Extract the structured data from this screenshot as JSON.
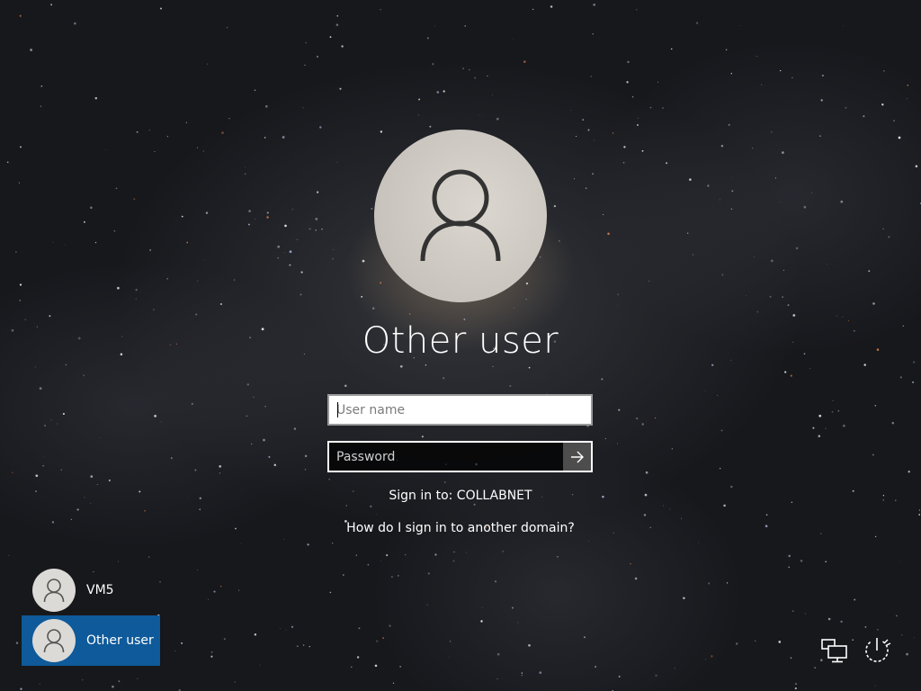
{
  "login": {
    "user_title": "Other user",
    "username_placeholder": "User name",
    "password_placeholder": "Password",
    "signin_to": "Sign in to: COLLABNET",
    "domain_help_link": "How do I sign in to another domain?"
  },
  "user_tiles": [
    {
      "label": "VM5",
      "selected": false
    },
    {
      "label": "Other user",
      "selected": true
    }
  ],
  "icons": {
    "avatar": "user-silhouette-icon",
    "submit": "arrow-right-icon",
    "network": "network-icon",
    "power": "power-icon"
  },
  "colors": {
    "selected_tile": "#0e5a9a",
    "avatar_bg": "#d3cfc9",
    "submit_button": "#4d4d4d"
  }
}
